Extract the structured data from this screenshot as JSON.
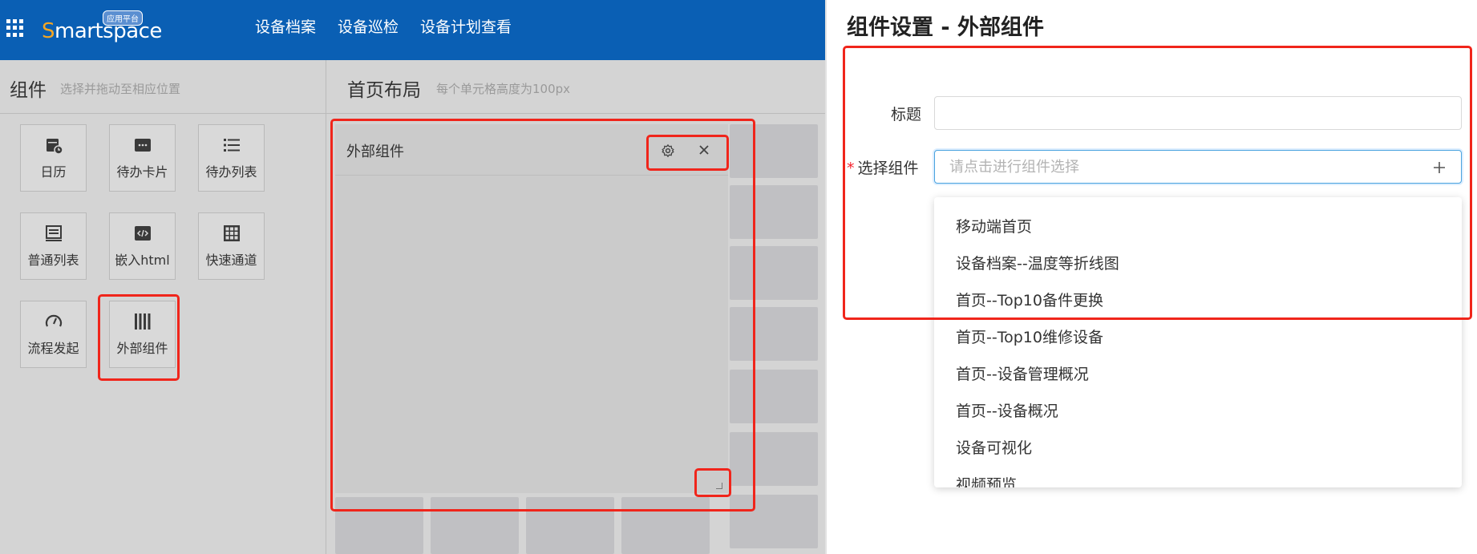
{
  "header": {
    "logo_text": "Smartspace",
    "logo_badge": "应用平台",
    "nav": [
      "设备档案",
      "设备巡检",
      "设备计划查看"
    ]
  },
  "components_panel": {
    "title": "组件",
    "subtitle": "选择并拖动至相应位置",
    "tiles": [
      {
        "label": "日历",
        "icon": "calendar-icon"
      },
      {
        "label": "待办卡片",
        "icon": "todo-card-icon"
      },
      {
        "label": "待办列表",
        "icon": "todo-list-icon"
      },
      {
        "label": "普通列表",
        "icon": "list-icon"
      },
      {
        "label": "嵌入html",
        "icon": "code-icon"
      },
      {
        "label": "快速通道",
        "icon": "shortcut-grid-icon"
      },
      {
        "label": "流程发起",
        "icon": "gauge-icon"
      },
      {
        "label": "外部组件",
        "icon": "barcode-icon"
      }
    ]
  },
  "layout_panel": {
    "title": "首页布局",
    "subtitle": "每个单元格高度为100px",
    "widget": {
      "title": "外部组件",
      "gear_icon": "gear-icon",
      "close_icon": "close-icon",
      "resize_icon": "resize-handle-icon"
    }
  },
  "settings": {
    "title": "组件设置 - 外部组件",
    "title_label": "标题",
    "title_value": "",
    "required_mark": "*",
    "select_label": "选择组件",
    "select_placeholder": "请点击进行组件选择",
    "plus_icon": "plus-icon",
    "options": [
      "移动端首页",
      "设备档案--温度等折线图",
      "首页--Top10备件更换",
      "首页--Top10维修设备",
      "首页--设备管理概况",
      "首页--设备概况",
      "设备可视化",
      "视频预览"
    ]
  },
  "colors": {
    "header_bg": "#0a5fb4",
    "highlight": "#f0251b",
    "focus_border": "#4aa3df",
    "panel_bg": "#d4d4d4"
  }
}
